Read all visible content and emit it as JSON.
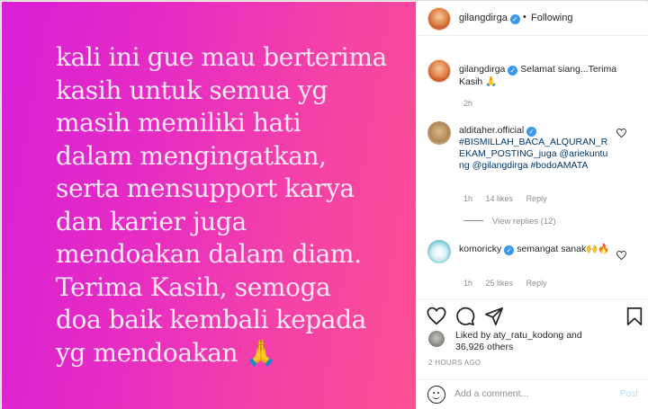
{
  "post": {
    "text": "kali ini gue mau berterima\nkasih untuk semua yg\nmasih memiliki hati\ndalam mengingatkan,\nserta mensupport karya\ndan karier juga\nmendoakan dalam diam.\nTerima Kasih, semoga\ndoa baik kembali kepada\nyg mendoakan 🙏",
    "background_colors": [
      "#d81fd6",
      "#fb4f93"
    ]
  },
  "header": {
    "username": "gilangdirga",
    "verified_icon": "verified-badge-icon",
    "separator": "•",
    "follow_status": "Following"
  },
  "caption": {
    "username": "gilangdirga",
    "text": "Selamat siang...Terima Kasih 🙏",
    "time": "2h"
  },
  "comments": [
    {
      "username": "alditaher.official",
      "text": "#BISMILLAH_BACA_ALQURAN_REKAM_POSTING_juga @ariekuntung @gilangdirga #bodoAMATA",
      "time": "1h",
      "likes": "14 likes",
      "reply_label": "Reply",
      "view_replies": "View replies (12)"
    },
    {
      "username": "komoricky",
      "text": "semangat sanak🙌🔥",
      "time": "1h",
      "likes": "25 likes",
      "reply_label": "Reply"
    }
  ],
  "likes": {
    "prefix": "Liked by",
    "user": "aty_ratu_kodong",
    "connector": "and",
    "others": "36,926 others"
  },
  "time_ago": "2 HOURS AGO",
  "comment_box": {
    "placeholder": "Add a comment...",
    "post_label": "Post"
  },
  "accent_color": "#3897f0"
}
